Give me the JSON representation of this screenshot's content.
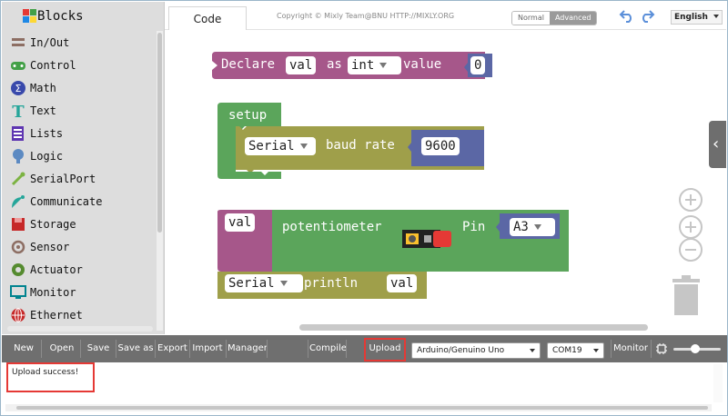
{
  "sidebar": {
    "title": "Blocks",
    "categories": [
      {
        "label": "In/Out",
        "icon": "in-out-icon"
      },
      {
        "label": "Control",
        "icon": "gamepad-icon"
      },
      {
        "label": "Math",
        "icon": "math-icon"
      },
      {
        "label": "Text",
        "icon": "text-icon"
      },
      {
        "label": "Lists",
        "icon": "lists-icon"
      },
      {
        "label": "Logic",
        "icon": "bulb-icon"
      },
      {
        "label": "SerialPort",
        "icon": "serial-port-icon"
      },
      {
        "label": "Communicate",
        "icon": "satellite-icon"
      },
      {
        "label": "Storage",
        "icon": "storage-icon"
      },
      {
        "label": "Sensor",
        "icon": "sensor-icon"
      },
      {
        "label": "Actuator",
        "icon": "actuator-icon"
      },
      {
        "label": "Monitor",
        "icon": "monitor-icon"
      },
      {
        "label": "Ethernet",
        "icon": "ethernet-icon"
      }
    ]
  },
  "topbar": {
    "tab_label": "Code",
    "copyright": "Copyright © Mixly Team@BNU HTTP://MIXLY.ORG",
    "mode_normal": "Normal",
    "mode_advanced": "Advanced",
    "language": "English"
  },
  "workspace": {
    "declare": {
      "keyword": "Declare",
      "var_name": "val",
      "as_label": "as",
      "type": "int",
      "value_label": "value",
      "value": "0"
    },
    "setup": {
      "label": "setup",
      "serial": "Serial",
      "baud_label": "baud rate",
      "baud": "9600"
    },
    "potentiometer": {
      "var_name": "val",
      "label": "potentiometer",
      "pin_label": "Pin",
      "pin": "A3"
    },
    "println": {
      "serial": "Serial",
      "label": "println",
      "arg": "val"
    }
  },
  "toolbar": {
    "new": "New",
    "open": "Open",
    "save": "Save",
    "save_as": "Save as",
    "export": "Export",
    "import": "Import",
    "manager": "Manager",
    "compile": "Compile",
    "upload": "Upload",
    "board": "Arduino/Genuino Uno",
    "port": "COM19",
    "monitor": "Monitor"
  },
  "output": {
    "message": "Upload success!"
  },
  "colors": {
    "declare_block": "#a6578a",
    "number_block": "#5b67a5",
    "setup_block": "#5ba55b",
    "serial_block": "#9f9f4a",
    "toolbar_bg": "#6f6f6f",
    "highlight": "#e53935"
  }
}
